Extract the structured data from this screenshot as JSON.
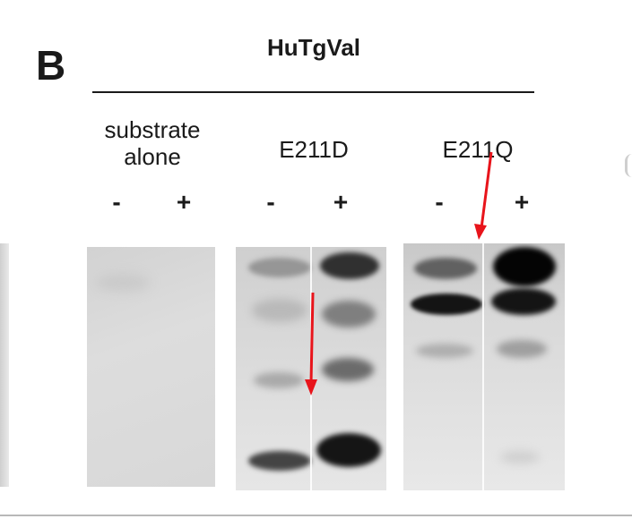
{
  "figure": {
    "panel_letter": "B",
    "title": "HuTgVal"
  },
  "groups": [
    {
      "label_line1": "substrate",
      "label_line2": "alone",
      "minus": "-",
      "plus": "+"
    },
    {
      "label_line1": "E211D",
      "label_line2": "",
      "minus": "-",
      "plus": "+"
    },
    {
      "label_line1": "E211Q",
      "label_line2": "",
      "minus": "-",
      "plus": "+"
    }
  ],
  "colors": {
    "arrow": "#e8141b",
    "blot_background": "#d9d9d9",
    "band_dark": "#111111"
  }
}
